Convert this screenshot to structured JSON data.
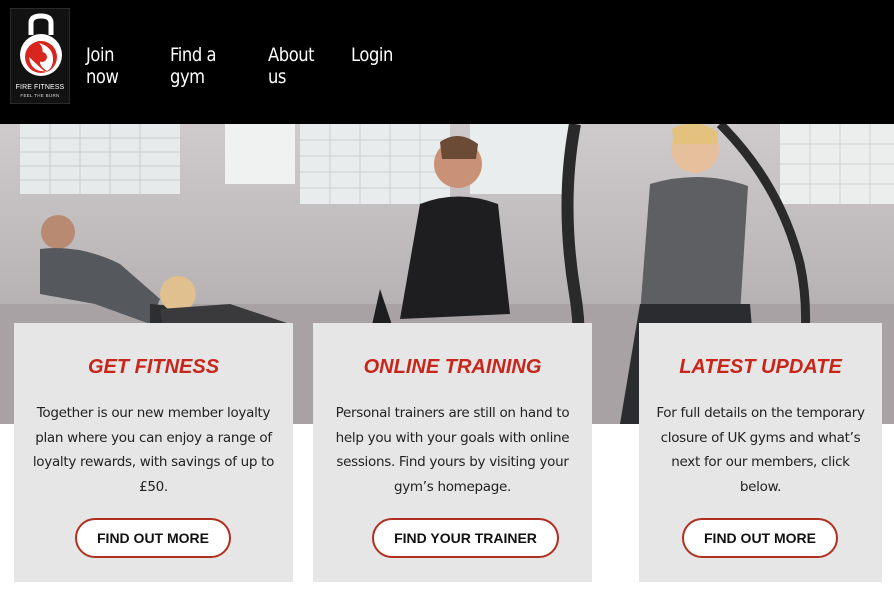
{
  "brand": {
    "name": "FIRE FITNESS",
    "tagline": "FEEL THE BURN",
    "logo_icon": "kettlebell-flame-icon",
    "accent_color": "#c8261b"
  },
  "nav": {
    "items": [
      {
        "label": "Join now"
      },
      {
        "label": "Find a gym"
      },
      {
        "label": "About us"
      },
      {
        "label": "Login"
      }
    ]
  },
  "cards": [
    {
      "title": "GET FITNESS",
      "body": "Together is our new member loyalty plan where you can enjoy a range of loyalty rewards, with savings of up to £50.",
      "button": "FIND OUT MORE"
    },
    {
      "title": "ONLINE TRAINING",
      "body": "Personal trainers are still on hand to help you with your goals with online sessions. Find yours by visiting your gym’s homepage.",
      "button": "FIND YOUR TRAINER"
    },
    {
      "title": "LATEST UPDATE",
      "body": "For full details on the temporary closure of UK gyms and what’s next for our members, click below.",
      "button": "FIND OUT MORE"
    }
  ]
}
